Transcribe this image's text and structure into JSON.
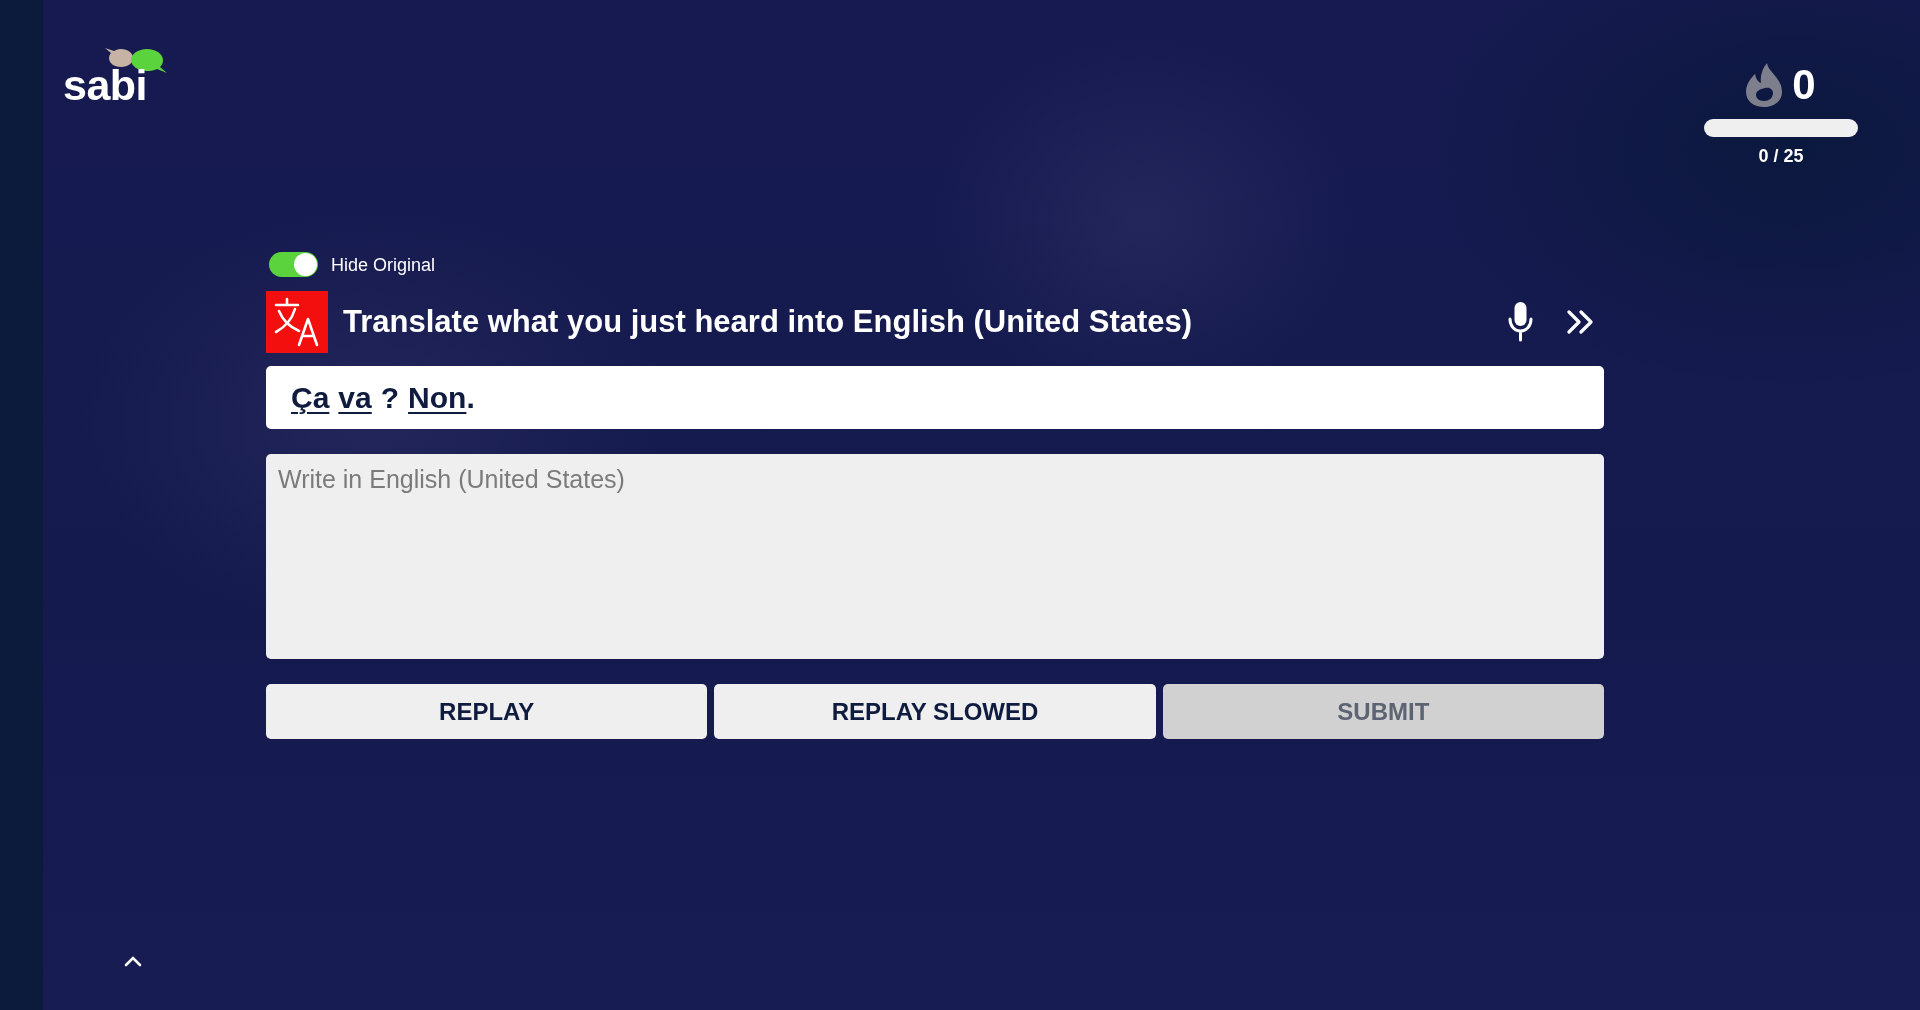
{
  "logo": {
    "text": "sabi"
  },
  "streak": {
    "count": "0",
    "level": 0,
    "progress_text": "0 / 25"
  },
  "toggle": {
    "label": "Hide Original",
    "on": true
  },
  "prompt": {
    "title": "Translate what you just heard into English (United States)"
  },
  "sentence": {
    "tokens": [
      {
        "kind": "word",
        "text": "Ça"
      },
      {
        "kind": "word",
        "text": "va"
      },
      {
        "kind": "punct",
        "text": "?"
      },
      {
        "kind": "word",
        "text": "Non"
      },
      {
        "kind": "stop",
        "text": "."
      }
    ]
  },
  "answer": {
    "placeholder": "Write in English (United States)"
  },
  "buttons": [
    {
      "label": "REPLAY",
      "disabled": false
    },
    {
      "label": "REPLAY SLOWED",
      "disabled": false
    },
    {
      "label": "SUBMIT",
      "disabled": true
    }
  ]
}
